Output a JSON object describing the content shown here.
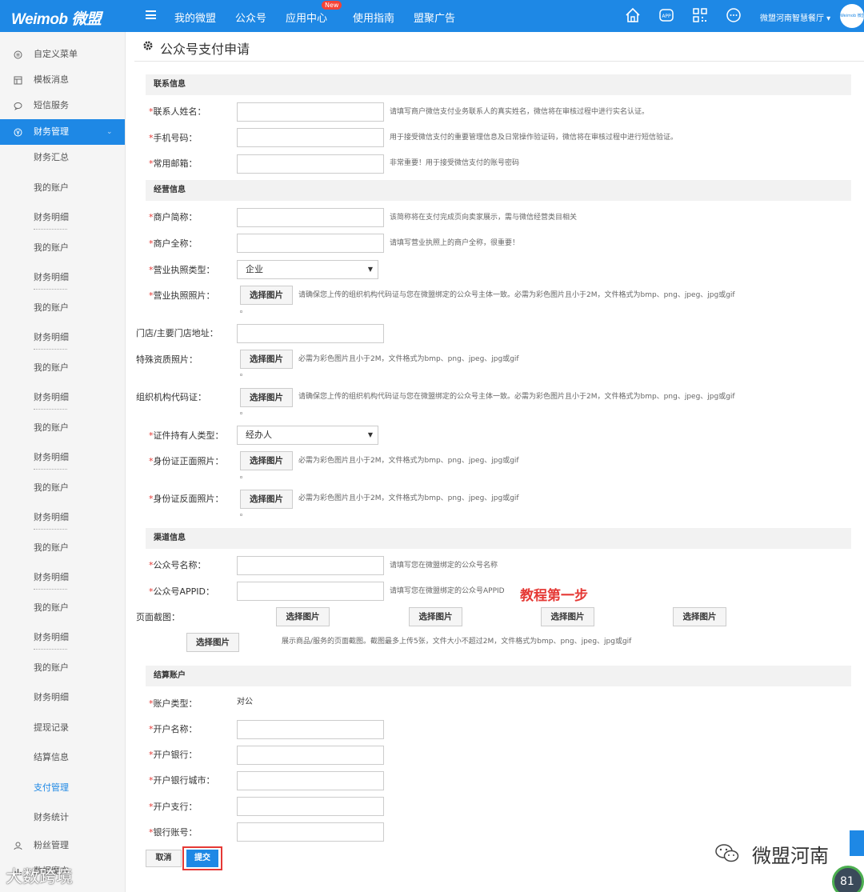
{
  "topbar": {
    "logo": "Weimob 微盟",
    "nav": [
      "我的微盟",
      "公众号",
      "应用中心",
      "使用指南",
      "盟聚广告"
    ],
    "new_badge": "New",
    "user": "微盟河南智慧餐厅",
    "avatar_text": "Weimob 微盟",
    "icons": [
      "home-icon",
      "app-icon",
      "qrcode-icon",
      "chat-icon"
    ]
  },
  "sidebar": {
    "top_items": [
      {
        "label": "自定义菜单",
        "icon": "menu-circle-icon"
      },
      {
        "label": "模板消息",
        "icon": "template-icon"
      },
      {
        "label": "短信服务",
        "icon": "sms-icon"
      }
    ],
    "active": {
      "label": "财务管理",
      "icon": "finance-icon",
      "chevron": "⌄"
    },
    "sub_items": [
      "财务汇总",
      "我的账户",
      "财务明细",
      "我的账户",
      "财务明细",
      "我的账户",
      "财务明细",
      "我的账户",
      "财务明细",
      "我的账户",
      "财务明细",
      "我的账户",
      "财务明细",
      "我的账户",
      "财务明细",
      "我的账户",
      "财务明细",
      "我的账户",
      "财务明细",
      "提现记录",
      "结算信息",
      "支付管理",
      "财务统计"
    ],
    "bottom_items": [
      {
        "label": "粉丝管理",
        "icon": "fans-icon"
      },
      {
        "label": "数据魔方",
        "icon": "data-icon"
      }
    ]
  },
  "page": {
    "title": "公众号支付申请"
  },
  "form": {
    "sections": {
      "contact": "联系信息",
      "business": "经营信息",
      "channel": "渠道信息",
      "settle": "结算账户"
    },
    "contact_name": {
      "label": "联系人姓名：",
      "hint": "请填写商户微信支付业务联系人的真实姓名，微信将在审核过程中进行实名认证。"
    },
    "phone": {
      "label": "手机号码：",
      "hint": "用于接受微信支付的重要管理信息及日常操作验证码，微信将在审核过程中进行短信验证。"
    },
    "email": {
      "label": "常用邮箱：",
      "hint": "非常重要！用于接受微信支付的账号密码"
    },
    "short_name": {
      "label": "商户简称：",
      "hint": "该简称将在支付完成页向卖家展示，需与微信经营类目相关"
    },
    "full_name": {
      "label": "商户全称：",
      "hint": "请填写营业执照上的商户全称，很重要！"
    },
    "license_type": {
      "label": "营业执照类型：",
      "value": "企业"
    },
    "license_photo": {
      "label": "营业执照照片：",
      "hint": "请确保您上传的组织机构代码证与您在微盟绑定的公众号主体一致。必需为彩色图片且小于2M，文件格式为bmp、png、jpeg、jpg或gif"
    },
    "store_addr": {
      "label": "门店/主要门店地址："
    },
    "special_photo": {
      "label": "特殊资质照片：",
      "hint": "必需为彩色图片且小于2M，文件格式为bmp、png、jpeg、jpg或gif"
    },
    "org_code": {
      "label": "组织机构代码证：",
      "hint": "请确保您上传的组织机构代码证与您在微盟绑定的公众号主体一致。必需为彩色图片且小于2M，文件格式为bmp、png、jpeg、jpg或gif"
    },
    "holder_type": {
      "label": "证件持有人类型：",
      "value": "经办人"
    },
    "id_front": {
      "label": "身份证正面照片：",
      "hint": "必需为彩色图片且小于2M，文件格式为bmp、png、jpeg、jpg或gif"
    },
    "id_back": {
      "label": "身份证反面照片：",
      "hint": "必需为彩色图片且小于2M，文件格式为bmp、png、jpeg、jpg或gif"
    },
    "mp_name": {
      "label": "公众号名称：",
      "hint": "请填写您在微盟绑定的公众号名称"
    },
    "mp_appid": {
      "label": "公众号APPID：",
      "hint": "请填写您在微盟绑定的公众号APPID"
    },
    "screenshot": {
      "label": "页面截图：",
      "hint": "展示商品/服务的页面截图。截图最多上传5张，文件大小不超过2M，文件格式为bmp、png、jpeg、jpg或gif"
    },
    "account_type": {
      "label": "账户类型：",
      "value": "对公"
    },
    "account_name": {
      "label": "开户名称："
    },
    "bank": {
      "label": "开户银行："
    },
    "bank_city": {
      "label": "开户银行城市："
    },
    "branch": {
      "label": "开户支行："
    },
    "account_no": {
      "label": "银行账号："
    },
    "choose_btn": "选择图片",
    "required_mark": "*"
  },
  "annotation": "教程第一步",
  "actions": {
    "cancel": "取消",
    "submit": "提交"
  },
  "watermark": "微盟河南",
  "watermark_left": "大数跨境",
  "gauge_value": "81",
  "colors": {
    "primary": "#1e88e5",
    "required": "#e53935",
    "annotation": "#e53935"
  }
}
